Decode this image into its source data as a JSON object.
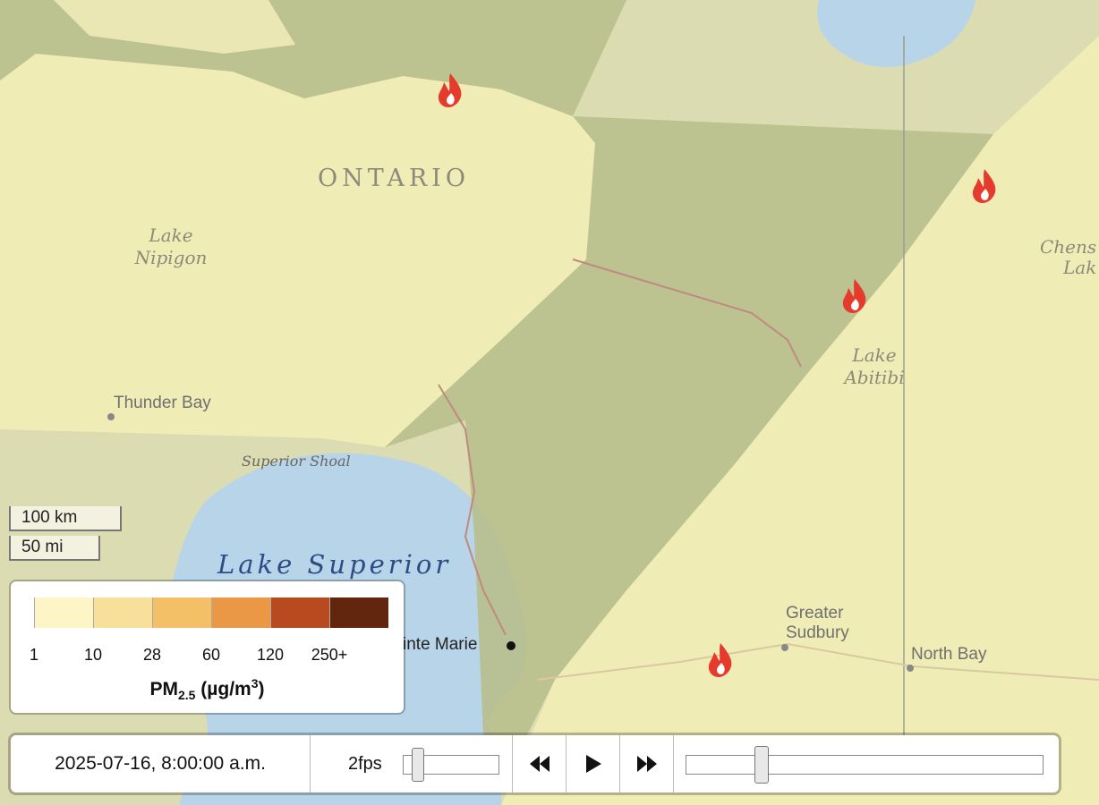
{
  "map": {
    "labels": {
      "province": "ONTARIO",
      "lake_nipigon_1": "Lake",
      "lake_nipigon_2": "Nipigon",
      "thunder_bay": "Thunder Bay",
      "superior_shoal": "Superior Shoal",
      "lake_superior": "Lake Superior",
      "lake_abitibi_1": "Lake",
      "lake_abitibi_2": "Abitibi",
      "greater_sudbury_1": "Greater",
      "greater_sudbury_2": "Sudbury",
      "north_bay": "North Bay",
      "sault_ste_marie": "inte Marie",
      "chensagi_1": "Chens",
      "chensagi_2": "Lak"
    },
    "fire_icon": "fire-icon"
  },
  "scale": {
    "km": "100 km",
    "mi": "50 mi"
  },
  "legend": {
    "colors": [
      "#fdf5c6",
      "#f8e09a",
      "#f4c067",
      "#ea9846",
      "#b84a20",
      "#62260f"
    ],
    "ticks": [
      "1",
      "10",
      "28",
      "60",
      "120",
      "250+"
    ],
    "title_main": "PM",
    "title_sub": "2.5",
    "title_unit_pre": " (µg/m",
    "title_unit_sup": "3",
    "title_unit_post": ")"
  },
  "controls": {
    "datetime": "2025-07-16, 8:00:00 a.m.",
    "fps": "2fps",
    "fps_level": 0.1,
    "time_position": 0.2,
    "rewind_icon": "rewind-icon",
    "play_icon": "play-icon",
    "forward_icon": "fast-forward-icon"
  }
}
